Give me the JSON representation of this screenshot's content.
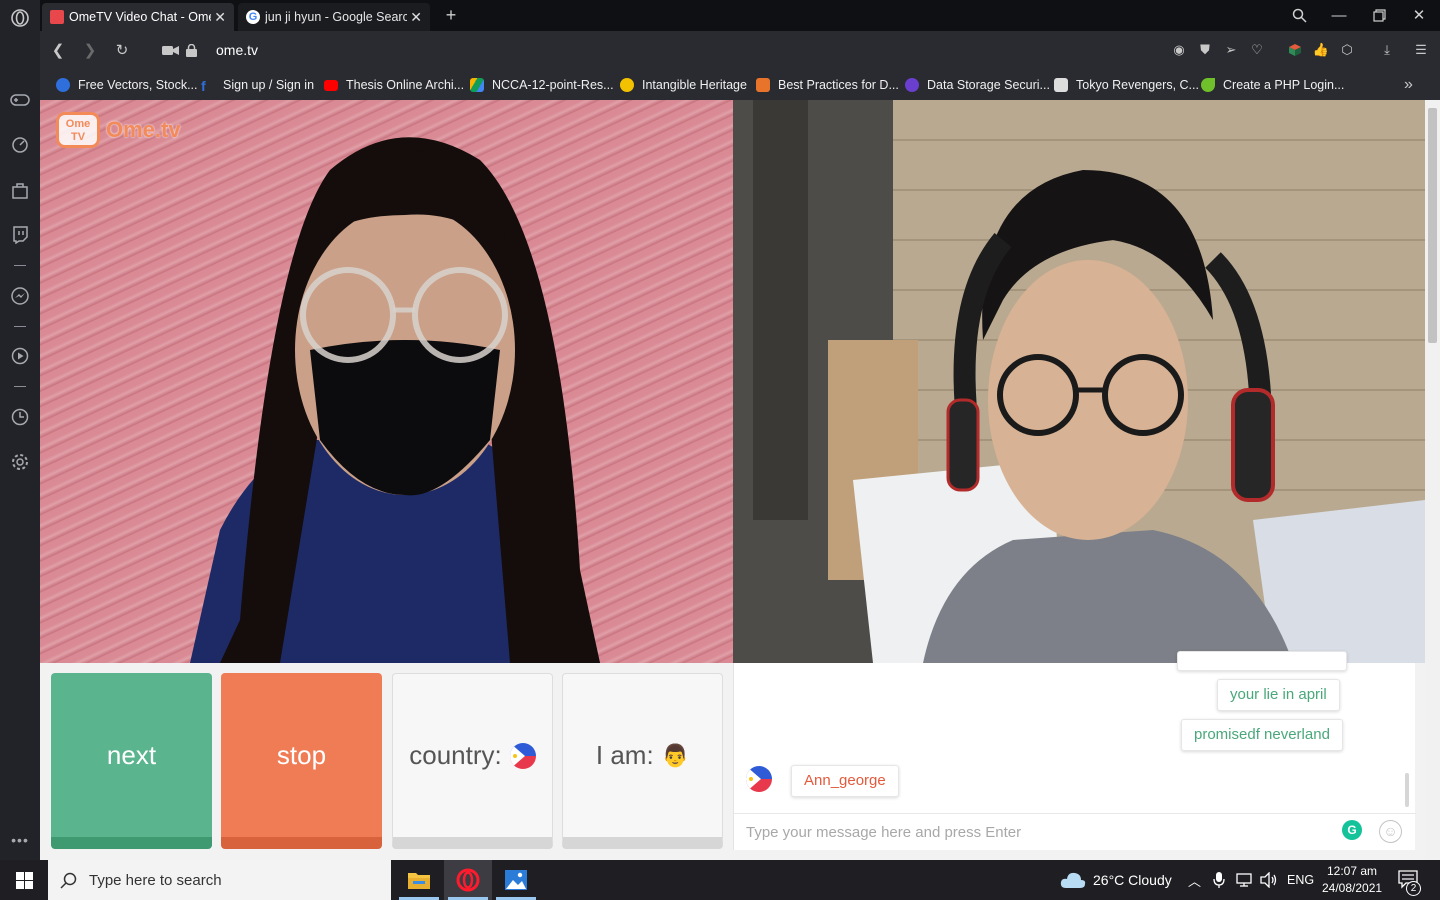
{
  "browser": {
    "tabs": [
      {
        "title": "OmeTV Video Chat - Omegle",
        "active": true
      },
      {
        "title": "jun ji hyun - Google Search",
        "active": false
      }
    ],
    "url": "ome.tv",
    "bookmarks": [
      "Free Vectors, Stock...",
      "Sign up / Sign in",
      "Thesis Online Archi...",
      "NCCA-12-point-Res...",
      "Intangible Heritage",
      "Best Practices for D...",
      "Data Storage Securi...",
      "Tokyo Revengers, C...",
      "Create a PHP Login..."
    ],
    "more_bookmarks_glyph": "»"
  },
  "site": {
    "logo_small": "Ome TV",
    "logo_text": "Ome.tv"
  },
  "controls": {
    "next_label": "next",
    "stop_label": "stop",
    "country_label": "country:",
    "iam_label": "I am:",
    "country_flag_icon": "philippines-flag-icon",
    "iam_icon": "man-emoji-icon"
  },
  "chat": {
    "messages": [
      {
        "text": "your lie in april",
        "from": "me"
      },
      {
        "text": "promisedf neverland",
        "from": "me"
      }
    ],
    "partner_name": "Ann_george",
    "input_placeholder": "Type your message here and press Enter"
  },
  "taskbar": {
    "search_placeholder": "Type here to search",
    "weather": "26°C  Cloudy",
    "language": "ENG",
    "time": "12:07 am",
    "date": "24/08/2021",
    "notifications": "2"
  },
  "colors": {
    "next": "#5ab48e",
    "stop": "#f07c56",
    "brand": "#f28a5a",
    "opera_red": "#ff1b2d"
  }
}
